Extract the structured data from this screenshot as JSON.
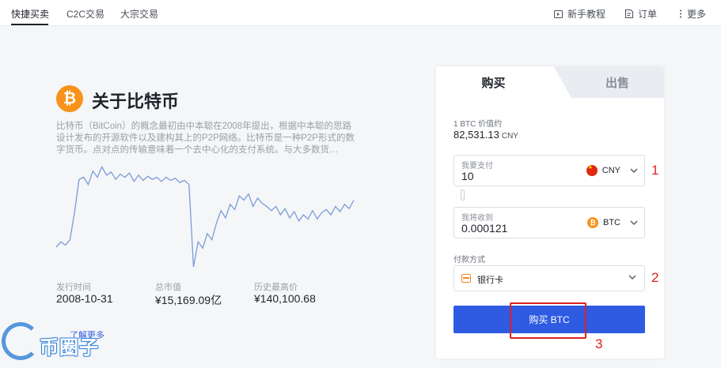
{
  "nav": {
    "tabs": [
      "快捷买卖",
      "C2C交易",
      "大宗交易"
    ],
    "right_links": [
      "新手教程",
      "订单",
      "更多"
    ]
  },
  "coin": {
    "icon_letter": "₿",
    "title": "关于比特币",
    "description": "比特币（BitCoin）的概念最初由中本聪在2008年提出，根据中本聪的思路设计发布的开源软件以及建构其上的P2P网络。比特币是一种P2P形式的数字货币。点对点的传输意味着一个去中心化的支付系统。与大多数货…",
    "stats": [
      {
        "label": "发行时间",
        "value": "2008-10-31"
      },
      {
        "label": "总市值",
        "value": "¥15,169.09亿"
      },
      {
        "label": "历史最高价",
        "value": "¥140,100.68"
      }
    ],
    "more_link": "了解更多"
  },
  "price_chart": {
    "line_color": "#7a9cd6",
    "values": [
      0.19,
      0.24,
      0.21,
      0.26,
      0.52,
      0.84,
      0.86,
      0.79,
      0.92,
      0.86,
      0.96,
      0.88,
      0.91,
      0.84,
      0.89,
      0.86,
      0.9,
      0.82,
      0.88,
      0.83,
      0.87,
      0.84,
      0.86,
      0.82,
      0.86,
      0.83,
      0.85,
      0.81,
      0.83,
      0.79,
      0.0,
      0.24,
      0.18,
      0.32,
      0.26,
      0.42,
      0.54,
      0.47,
      0.6,
      0.55,
      0.68,
      0.64,
      0.7,
      0.58,
      0.66,
      0.61,
      0.58,
      0.54,
      0.58,
      0.5,
      0.56,
      0.47,
      0.53,
      0.44,
      0.5,
      0.46,
      0.54,
      0.46,
      0.52,
      0.55,
      0.5,
      0.58,
      0.53,
      0.6,
      0.56,
      0.64
    ]
  },
  "trade": {
    "tab_buy": "购买",
    "tab_sell": "出售",
    "price_label": "1 BTC 价值约",
    "price_value": "82,531.13",
    "price_unit": "CNY",
    "pay_field_label": "我要支付",
    "pay_field_value": "10",
    "pay_currency": "CNY",
    "receive_field_label": "我将收到",
    "receive_field_value": "0.000121",
    "receive_currency": "BTC",
    "payment_method_label": "付款方式",
    "payment_method_value": "银行卡",
    "buy_button": "购买 BTC"
  },
  "annotations": [
    "1",
    "2",
    "3"
  ],
  "watermark": "币圈子",
  "colors": {
    "accent": "#2f5be3",
    "annotation": "#e02020",
    "btc": "#f7931a"
  }
}
